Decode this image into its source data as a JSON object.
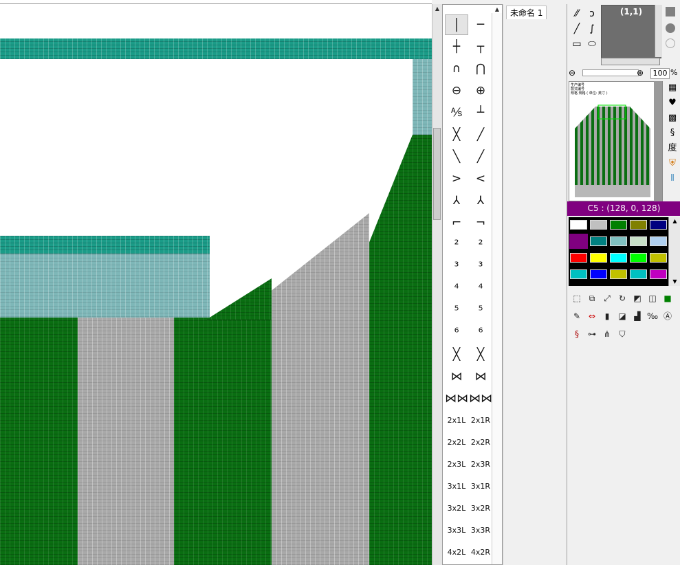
{
  "canvas": {
    "colors": {
      "teal": "#1b9c88",
      "light_teal": "#7eb7b8",
      "green": "#0a6e12",
      "gray": "#a9a9a9",
      "background": "#ffffff"
    }
  },
  "stitch_palette": {
    "symbols": [
      [
        "│",
        "─"
      ],
      [
        "┼",
        "┬"
      ],
      [
        "∩",
        "⋂"
      ],
      [
        "⊖",
        "⊕"
      ],
      [
        "⅍",
        "┴"
      ],
      [
        "╳",
        "╱"
      ],
      [
        "╲",
        "╱"
      ],
      [
        ">",
        "<"
      ],
      [
        "⅄",
        "⅄"
      ],
      [
        "⌐",
        "¬"
      ],
      [
        "²",
        "²"
      ],
      [
        "³",
        "³"
      ],
      [
        "⁴",
        "⁴"
      ],
      [
        "⁵",
        "⁵"
      ],
      [
        "⁶",
        "⁶"
      ],
      [
        "╳",
        "╳"
      ],
      [
        "⋈",
        "⋈"
      ],
      [
        "⋈⋈",
        "⋈⋈"
      ]
    ],
    "labels": [
      [
        "2x1L",
        "2x1R"
      ],
      [
        "2x2L",
        "2x2R"
      ],
      [
        "2x3L",
        "2x3R"
      ],
      [
        "3x1L",
        "3x1R"
      ],
      [
        "3x2L",
        "3x2R"
      ],
      [
        "3x3L",
        "3x3R"
      ],
      [
        "4x2L",
        "4x2R"
      ]
    ]
  },
  "tabs": {
    "active": "未命名 1"
  },
  "preview": {
    "coordinate": "(1,1)"
  },
  "zoom": {
    "value": "100",
    "unit": "%"
  },
  "minimap": {
    "lines": [
      "生产编号",
      "款式编号",
      "规格 规格 ( 单位: 英寸 )"
    ]
  },
  "sidetools": {
    "degree_label": "度"
  },
  "color": {
    "selected_label": "C5 : (128, 0, 128)",
    "selected_hex": "#800080",
    "swatches": [
      "#ffffff",
      "#c0c0c0",
      "#008000",
      "#808000",
      "#000080",
      "#800080",
      "#008080",
      "#80c0c0",
      "#c8e0c8",
      "#b0d0f0",
      "#ff0000",
      "#ffff00",
      "#00ffff",
      "#00ff00",
      "#c0c000",
      "#00c0c0",
      "#0000ff",
      "#c0c000",
      "#00c0c0",
      "#c000c0"
    ]
  }
}
